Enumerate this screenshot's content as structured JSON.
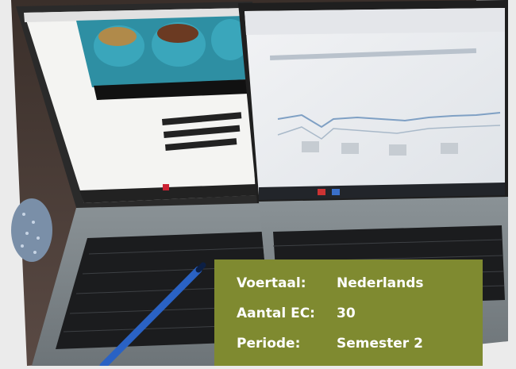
{
  "info_panel": {
    "rows": [
      {
        "label": "Voertaal:",
        "value": "Nederlands"
      },
      {
        "label": "Aantal EC:",
        "value": "30"
      },
      {
        "label": "Periode:",
        "value": "Semester 2"
      }
    ]
  },
  "colors": {
    "page_background": "#ebebeb",
    "info_panel_background": "#7f8a30",
    "info_panel_text": "#ffffff"
  },
  "scene": {
    "description_icons": [
      "laptop-left",
      "laptop-right",
      "pen",
      "keyboard"
    ]
  }
}
